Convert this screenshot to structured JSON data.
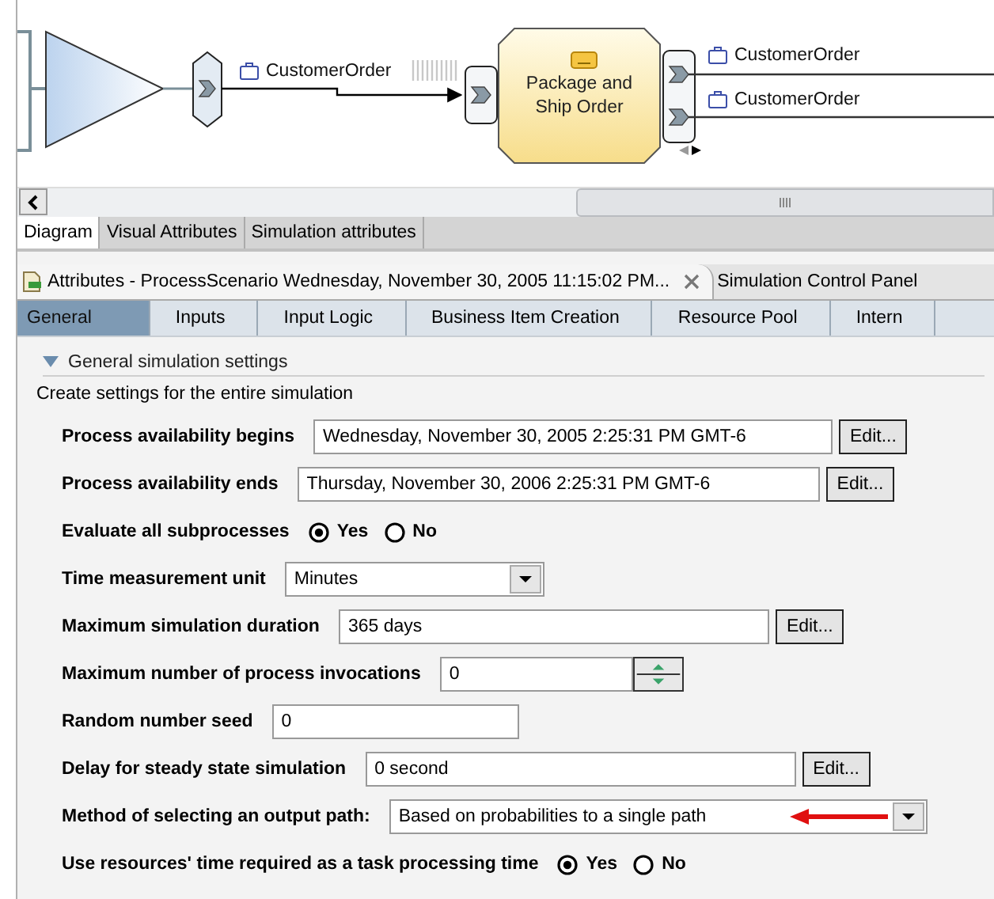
{
  "diagram": {
    "task": {
      "label": "Package and Ship Order"
    },
    "items": [
      {
        "label": "CustomerOrder",
        "kind": "input"
      },
      {
        "label": "CustomerOrder",
        "kind": "output-top"
      },
      {
        "label": "CustomerOrder",
        "kind": "output-bottom"
      }
    ]
  },
  "editor_tabs": [
    {
      "label": "Diagram",
      "selected": true
    },
    {
      "label": "Visual Attributes",
      "selected": false
    },
    {
      "label": "Simulation attributes",
      "selected": false
    }
  ],
  "view_tabs": [
    {
      "label": "Attributes - ProcessScenario Wednesday, November 30, 2005 11:15:02 PM...",
      "selected": true,
      "closable": true
    },
    {
      "label": "Simulation Control Panel",
      "selected": false,
      "closable": false
    }
  ],
  "section_tabs": [
    {
      "label": "General",
      "selected": true
    },
    {
      "label": "Inputs",
      "selected": false
    },
    {
      "label": "Input Logic",
      "selected": false
    },
    {
      "label": "Business Item Creation",
      "selected": false
    },
    {
      "label": "Resource Pool",
      "selected": false
    },
    {
      "label": "Intern",
      "selected": false
    }
  ],
  "section": {
    "title": "General simulation settings",
    "expanded": true,
    "description": "Create settings for the entire simulation"
  },
  "fields": [
    {
      "kind": "text",
      "label": "Process availability begins",
      "value": "Wednesday, November 30, 2005 2:25:31 PM GMT-6",
      "button": "Edit..."
    },
    {
      "kind": "text",
      "label": "Process availability ends",
      "value": "Thursday, November 30, 2006 2:25:31 PM GMT-6",
      "button": "Edit..."
    },
    {
      "kind": "radio",
      "label": "Evaluate all subprocesses",
      "options": [
        {
          "label": "Yes",
          "selected": true
        },
        {
          "label": "No",
          "selected": false
        }
      ]
    },
    {
      "kind": "dropdown",
      "label": "Time measurement unit",
      "value": "Minutes"
    },
    {
      "kind": "text",
      "label": "Maximum simulation duration",
      "value": "365 days",
      "button": "Edit..."
    },
    {
      "kind": "spinner",
      "label": "Maximum number of process invocations",
      "value": "0"
    },
    {
      "kind": "text",
      "label": "Random number seed",
      "value": "0"
    },
    {
      "kind": "text",
      "label": "Delay for steady state simulation",
      "value": "0 second",
      "button": "Edit..."
    },
    {
      "kind": "dropdown",
      "label": "Method of selecting an output path:",
      "value": "Based on probabilities to a single path",
      "annotated": true
    },
    {
      "kind": "radio",
      "label": "Use resources' time required as a task processing time",
      "options": [
        {
          "label": "Yes",
          "selected": true
        },
        {
          "label": "No",
          "selected": false
        }
      ]
    }
  ]
}
